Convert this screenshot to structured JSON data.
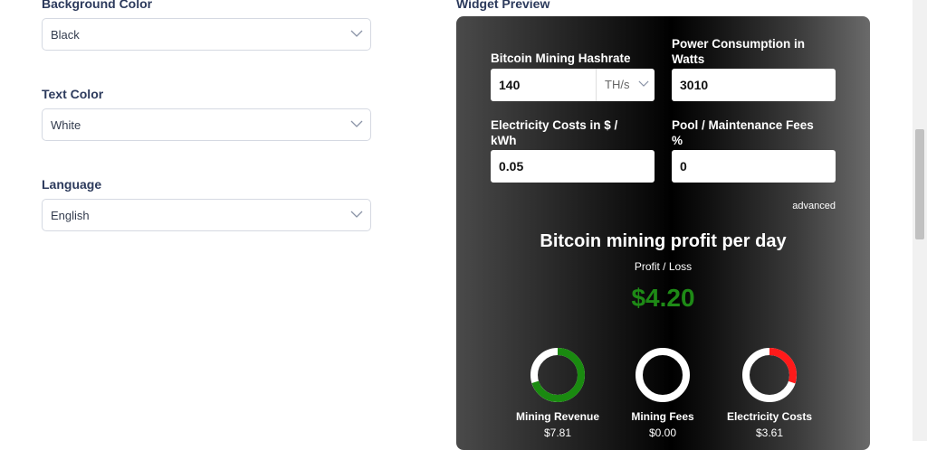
{
  "settings": {
    "background_color": {
      "label": "Background Color",
      "value": "Black"
    },
    "text_color": {
      "label": "Text Color",
      "value": "White"
    },
    "language": {
      "label": "Language",
      "value": "English"
    }
  },
  "preview": {
    "title": "Widget Preview",
    "hashrate": {
      "label": "Bitcoin Mining Hashrate",
      "value": "140",
      "unit": "TH/s"
    },
    "power": {
      "label_line1": "Power Consumption in",
      "label_line2": "Watts",
      "value": "3010"
    },
    "electricity": {
      "label_line1": "Electricity Costs in $ /",
      "label_line2": "kWh",
      "value": "0.05"
    },
    "pool_fees": {
      "label_line1": "Pool / Maintenance Fees",
      "label_line2": "%",
      "value": "0"
    },
    "advanced_link": "advanced",
    "profit_title": "Bitcoin mining profit per day",
    "profit_subtitle": "Profit / Loss",
    "profit_value": "$4.20",
    "breakdown": [
      {
        "label": "Mining Revenue",
        "value": "$7.81",
        "ring_color": "#1a8a10",
        "fill_fraction": 0.7
      },
      {
        "label": "Mining Fees",
        "value": "$0.00",
        "ring_color": "#ffffff",
        "fill_fraction": 0.0
      },
      {
        "label": "Electricity Costs",
        "value": "$3.61",
        "ring_color": "#ff1a1a",
        "fill_fraction": 0.3
      }
    ]
  },
  "colors": {
    "profit_green": "#1e8a16",
    "label_navy": "#2c3a5c"
  }
}
